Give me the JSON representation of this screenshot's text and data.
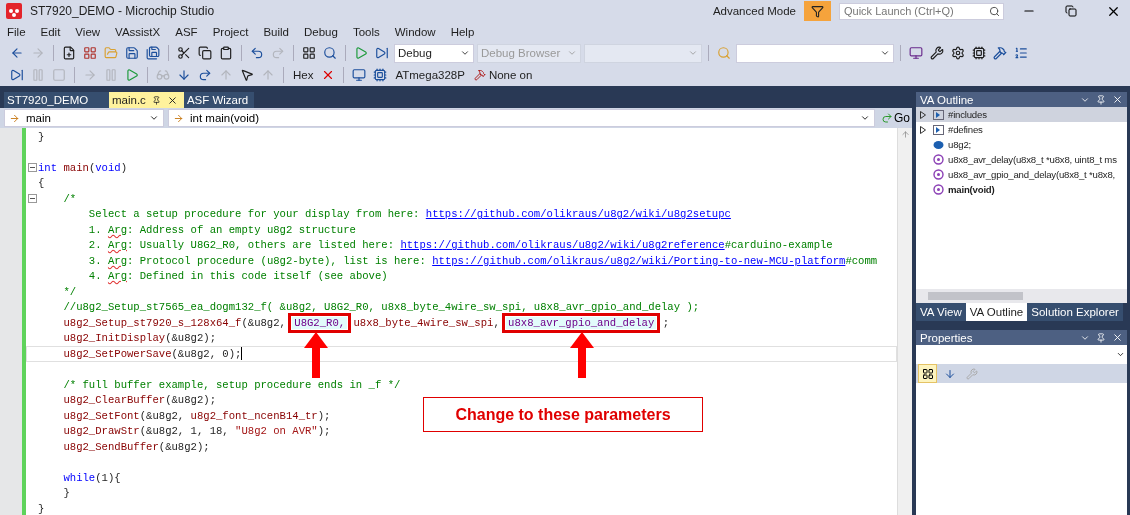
{
  "window": {
    "title": "ST7920_DEMO - Microchip Studio",
    "mode_label": "Advanced Mode",
    "quick_launch": {
      "placeholder": "Quick Launch (Ctrl+Q)"
    }
  },
  "menu": [
    "File",
    "Edit",
    "View",
    "VAssistX",
    "ASF",
    "Project",
    "Build",
    "Debug",
    "Tools",
    "Window",
    "Help"
  ],
  "toolbar": {
    "configuration": "Debug",
    "debug_browser": {
      "label": "Debug Browser",
      "disabled": true
    },
    "hex_label": "Hex",
    "device": "ATmega328P",
    "tool": "None on"
  },
  "doc_tabs": [
    {
      "label": "ST7920_DEMO",
      "selected": false
    },
    {
      "label": "main.c",
      "selected": true
    },
    {
      "label": "ASF Wizard",
      "selected": false
    }
  ],
  "nav": {
    "scope": "main",
    "member": "int main(void)",
    "go": "Go"
  },
  "code_lines": [
    {
      "foldable": false,
      "current": false,
      "segments": [
        {
          "kind": "plain",
          "text": "}"
        }
      ]
    },
    {
      "foldable": false,
      "current": false
    },
    {
      "foldable": true,
      "current": false,
      "segments": [
        {
          "kind": "keyword",
          "text": "int "
        },
        {
          "kind": "func",
          "text": "main"
        },
        {
          "kind": "plain",
          "text": "("
        },
        {
          "kind": "keyword",
          "text": "void"
        },
        {
          "kind": "plain",
          "text": ")"
        }
      ]
    },
    {
      "foldable": false,
      "current": false,
      "segments": [
        {
          "kind": "plain",
          "text": "{"
        }
      ]
    },
    {
      "foldable": true,
      "current": false,
      "segments": [
        {
          "kind": "comment",
          "text": "    /*"
        }
      ]
    },
    {
      "foldable": false,
      "current": false,
      "segments": [
        {
          "kind": "comment",
          "text": "        Select a setup procedure for your display from here: "
        },
        {
          "kind": "link",
          "text": "https://github.com/olikraus/u8g2/wiki/u8g2setupc"
        }
      ]
    },
    {
      "foldable": false,
      "current": false,
      "segments": [
        {
          "kind": "comment",
          "text": "        1. "
        },
        {
          "kind": "squiggle",
          "text": "Arg"
        },
        {
          "kind": "comment",
          "text": ": Address of an empty u8g2 structure"
        }
      ]
    },
    {
      "foldable": false,
      "current": false,
      "segments": [
        {
          "kind": "comment",
          "text": "        2. "
        },
        {
          "kind": "squiggle",
          "text": "Arg"
        },
        {
          "kind": "comment",
          "text": ": Usually U8G2_R0, others are listed here: "
        },
        {
          "kind": "link",
          "text": "https://github.com/olikraus/u8g2/wiki/u8g2reference"
        },
        {
          "kind": "comment",
          "text": "#carduino-example"
        }
      ]
    },
    {
      "foldable": false,
      "current": false,
      "segments": [
        {
          "kind": "comment",
          "text": "        3. "
        },
        {
          "kind": "squiggle",
          "text": "Arg"
        },
        {
          "kind": "comment",
          "text": ": Protocol procedure (u8g2-byte), list is here: "
        },
        {
          "kind": "link",
          "text": "https://github.com/olikraus/u8g2/wiki/Porting-to-new-MCU-platform"
        },
        {
          "kind": "comment",
          "text": "#comm"
        }
      ]
    },
    {
      "foldable": false,
      "current": false,
      "segments": [
        {
          "kind": "comment",
          "text": "        4. "
        },
        {
          "kind": "squiggle",
          "text": "Arg"
        },
        {
          "kind": "comment",
          "text": ": Defined in this code itself (see above)"
        }
      ]
    },
    {
      "foldable": false,
      "current": false,
      "segments": [
        {
          "kind": "comment",
          "text": "    */"
        }
      ]
    },
    {
      "foldable": false,
      "current": false,
      "segments": [
        {
          "kind": "comment",
          "text": "    //u8g2_Setup_st7565_ea_dogm132_f( &u8g2, U8G2_R0, u8x8_byte_4wire_sw_spi, u8x8_avr_gpio_and_delay );"
        }
      ]
    },
    {
      "foldable": false,
      "current": false,
      "segments": [
        {
          "kind": "func",
          "text": "    u8g2_Setup_st7920_s_128x64_f"
        },
        {
          "kind": "plain",
          "text": "(&u8g2, "
        },
        {
          "kind": "boxed",
          "text": "U8G2_R0,"
        },
        {
          "kind": "func",
          "text": " u8x8_byte_4wire_sw_spi"
        },
        {
          "kind": "plain",
          "text": ", "
        },
        {
          "kind": "boxed",
          "text": "u8x8_avr_gpio_and_delay"
        },
        {
          "kind": "plain",
          "text": " ;"
        }
      ]
    },
    {
      "foldable": false,
      "current": false,
      "segments": [
        {
          "kind": "func",
          "text": "    u8g2_InitDisplay"
        },
        {
          "kind": "plain",
          "text": "(&u8g2);"
        }
      ]
    },
    {
      "foldable": false,
      "current": true,
      "segments": [
        {
          "kind": "func",
          "text": "    u8g2_SetPowerSave"
        },
        {
          "kind": "plain",
          "text": "(&u8g2, 0);"
        }
      ]
    },
    {
      "foldable": false,
      "current": false
    },
    {
      "foldable": false,
      "current": false,
      "segments": [
        {
          "kind": "comment",
          "text": "    /* full buffer example, setup procedure ends in _f */"
        }
      ]
    },
    {
      "foldable": false,
      "current": false,
      "segments": [
        {
          "kind": "func",
          "text": "    u8g2_ClearBuffer"
        },
        {
          "kind": "plain",
          "text": "(&u8g2);"
        }
      ]
    },
    {
      "foldable": false,
      "current": false,
      "segments": [
        {
          "kind": "func",
          "text": "    u8g2_SetFont"
        },
        {
          "kind": "plain",
          "text": "(&u8g2, "
        },
        {
          "kind": "func",
          "text": "u8g2_font_ncenB14_tr"
        },
        {
          "kind": "plain",
          "text": ");"
        }
      ]
    },
    {
      "foldable": false,
      "current": false,
      "segments": [
        {
          "kind": "func",
          "text": "    u8g2_DrawStr"
        },
        {
          "kind": "plain",
          "text": "(&u8g2, 1, 18, "
        },
        {
          "kind": "string",
          "text": "\"U8g2 on AVR\""
        },
        {
          "kind": "plain",
          "text": ");"
        }
      ]
    },
    {
      "foldable": false,
      "current": false,
      "segments": [
        {
          "kind": "func",
          "text": "    u8g2_SendBuffer"
        },
        {
          "kind": "plain",
          "text": "(&u8g2);"
        }
      ]
    },
    {
      "foldable": false,
      "current": false
    },
    {
      "foldable": false,
      "current": false,
      "segments": [
        {
          "kind": "keyword",
          "text": "    while"
        },
        {
          "kind": "plain",
          "text": "(1){"
        }
      ]
    },
    {
      "foldable": false,
      "current": false,
      "segments": [
        {
          "kind": "plain",
          "text": "    }"
        }
      ]
    },
    {
      "foldable": false,
      "current": false,
      "segments": [
        {
          "kind": "plain",
          "text": "}"
        }
      ]
    }
  ],
  "annotation": {
    "callout": "Change to these parameters"
  },
  "outline": {
    "title": "VA Outline",
    "items": [
      {
        "kind": "group",
        "label": "#includes",
        "selected": true,
        "current": false
      },
      {
        "kind": "group",
        "label": "#defines",
        "selected": false,
        "current": false
      },
      {
        "kind": "variable",
        "label": "u8g2;",
        "selected": false,
        "current": false
      },
      {
        "kind": "function",
        "label": "u8x8_avr_delay(u8x8_t *u8x8, uint8_t ms",
        "selected": false,
        "current": false
      },
      {
        "kind": "function",
        "label": "u8x8_avr_gpio_and_delay(u8x8_t *u8x8,",
        "selected": false,
        "current": false
      },
      {
        "kind": "function",
        "label": "main(void)",
        "selected": false,
        "current": true
      }
    ]
  },
  "panel_tabs": [
    {
      "label": "VA View",
      "selected": false
    },
    {
      "label": "VA Outline",
      "selected": true
    },
    {
      "label": "Solution Explorer",
      "selected": false
    }
  ],
  "properties": {
    "title": "Properties"
  }
}
